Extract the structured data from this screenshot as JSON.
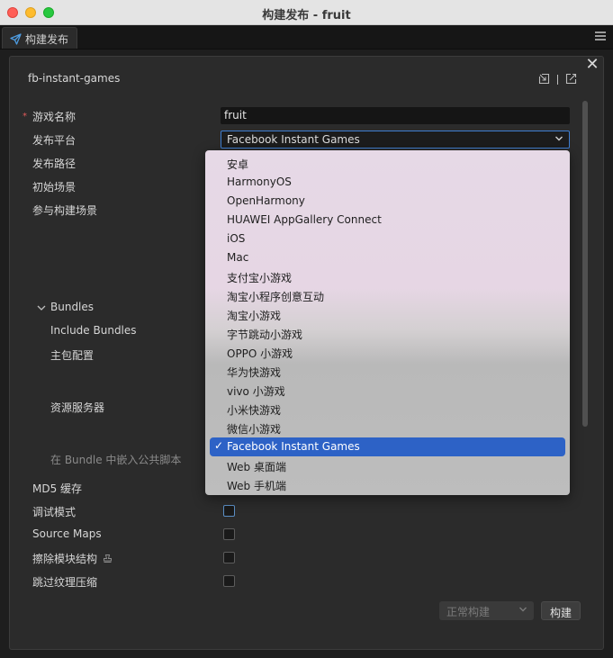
{
  "window": {
    "title": "构建发布 - fruit"
  },
  "tab": {
    "label": "构建发布"
  },
  "panel": {
    "config_name": "fb-instant-games"
  },
  "form": {
    "game_name_label": "游戏名称",
    "game_name_value": "fruit",
    "platform_label": "发布平台",
    "platform_value": "Facebook Instant Games",
    "build_path_label": "发布路径",
    "start_scene_label": "初始场景",
    "scenes_label": "参与构建场景",
    "bundles_label": "Bundles",
    "include_bundles_label": "Include Bundles",
    "main_bundle_label": "主包配置",
    "resource_server_label": "资源服务器",
    "embed_script_label": "在 Bundle 中嵌入公共脚本",
    "md5_label": "MD5 缓存",
    "debug_label": "调试模式",
    "sourcemaps_label": "Source Maps",
    "erase_module_label": "擦除模块结构",
    "skip_texture_label": "跳过纹理压缩"
  },
  "dropdown": {
    "options": [
      "安卓",
      "HarmonyOS",
      "OpenHarmony",
      "HUAWEI AppGallery Connect",
      "iOS",
      "Mac",
      "支付宝小游戏",
      "淘宝小程序创意互动",
      "淘宝小游戏",
      "字节跳动小游戏",
      "OPPO 小游戏",
      "华为快游戏",
      "vivo 小游戏",
      "小米快游戏",
      "微信小游戏",
      "Facebook Instant Games",
      "Web 桌面端",
      "Web 手机端"
    ],
    "selected": "Facebook Instant Games",
    "check_mark": "✓"
  },
  "checkboxes": {
    "debug": false,
    "sourcemaps": false,
    "erase_module": false,
    "skip_texture": false
  },
  "footer": {
    "build_mode": "正常构建",
    "build_button": "构建"
  },
  "icons": {
    "tab": "paper-plane-icon",
    "menu": "hamburger-menu-icon",
    "close": "close-icon",
    "import": "import-icon",
    "export": "export-icon",
    "erase_module_extra": "stamp-icon"
  },
  "colors": {
    "accent": "#2d62c6",
    "required": "#e05a5a"
  }
}
